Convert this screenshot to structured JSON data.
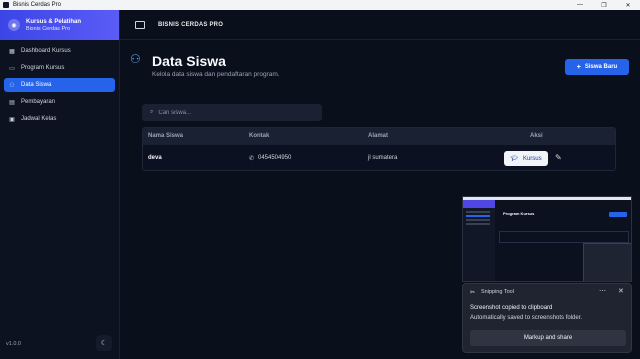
{
  "window": {
    "title": "Bisnis Cerdas Pro",
    "controls": {
      "minimize": "—",
      "maximize": "❐",
      "close": "✕"
    }
  },
  "sidebar": {
    "brand_title": "Kursus & Pelatihan",
    "brand_sub": "Bisnis Cerdas Pro",
    "items": [
      {
        "label": "Dashboard Kursus",
        "icon": "grid-icon",
        "glyph": "▦"
      },
      {
        "label": "Program Kursus",
        "icon": "book-icon",
        "glyph": "▭"
      },
      {
        "label": "Data Siswa",
        "icon": "users-icon",
        "glyph": "⚇",
        "active": true
      },
      {
        "label": "Pembayaran",
        "icon": "wallet-icon",
        "glyph": "▤"
      },
      {
        "label": "Jadwal Kelas",
        "icon": "calendar-icon",
        "glyph": "▣"
      }
    ],
    "version": "v1.0.0",
    "theme_glyph": "☾"
  },
  "header": {
    "title": "BISNIS CERDAS PRO"
  },
  "page": {
    "title": "Data Siswa",
    "subtitle": "Kelola data siswa dan pendaftaran program.",
    "add_button": "Siswa Baru"
  },
  "search": {
    "placeholder": "Cari siswa...",
    "value": ""
  },
  "table": {
    "headers": [
      "Nama Siswa",
      "Kontak",
      "Alamat",
      "Aksi"
    ],
    "rows": [
      {
        "name": "deva",
        "contact": "0454504950",
        "address": "jl sumatera",
        "action": "Kursus"
      }
    ]
  },
  "snipping_tool": {
    "app": "Snipping Tool",
    "line1": "Screenshot copied to clipboard",
    "line2": "Automatically saved to screenshots folder.",
    "button": "Markup and share",
    "thumb_title": "Program Kursus"
  },
  "colors": {
    "accent": "#2563eb",
    "brand_gradient_start": "#3b45e6",
    "brand_gradient_end": "#5b5cf6",
    "background": "#0a0f1c"
  }
}
